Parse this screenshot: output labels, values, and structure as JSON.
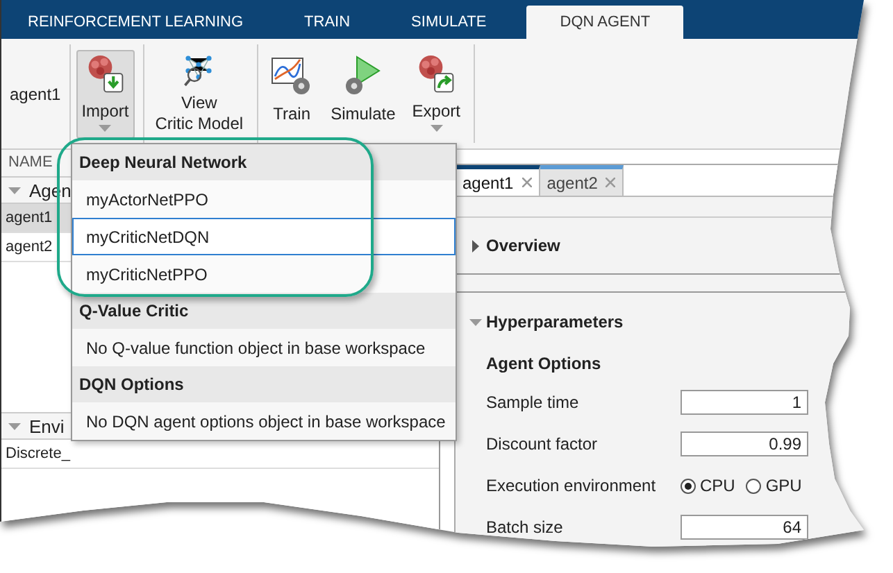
{
  "tabs": [
    {
      "label": "REINFORCEMENT LEARNING",
      "selected": false
    },
    {
      "label": "TRAIN",
      "selected": false
    },
    {
      "label": "SIMULATE",
      "selected": false
    },
    {
      "label": "DQN AGENT",
      "selected": true
    }
  ],
  "toolstrip": {
    "agent_label": "agent1",
    "groups": [
      [
        {
          "kind": "import",
          "label": "Import",
          "pressed": true,
          "has_menu": true
        }
      ],
      [
        {
          "kind": "view",
          "label": "View\nCritic Model",
          "pressed": false,
          "has_menu": false
        }
      ],
      [
        {
          "kind": "train",
          "label": "Train",
          "pressed": false,
          "has_menu": false
        },
        {
          "kind": "simulate",
          "label": "Simulate",
          "pressed": false,
          "has_menu": false
        },
        {
          "kind": "export",
          "label": "Export",
          "pressed": false,
          "has_menu": true
        }
      ]
    ]
  },
  "browser": {
    "name_header": "NAME",
    "sections": [
      {
        "title": "Agen",
        "expanded": true,
        "items": [
          {
            "label": "agent1",
            "selected": true
          },
          {
            "label": "agent2",
            "selected": false
          }
        ]
      },
      {
        "title": "Envi",
        "expanded": true,
        "items": [
          {
            "label": "Discrete_",
            "selected": false
          }
        ]
      }
    ]
  },
  "import_menu": {
    "sections": [
      {
        "header": "Deep Neural Network",
        "items": [
          {
            "kind": "option",
            "label": "myActorNetPPO",
            "selected": false
          },
          {
            "kind": "option",
            "label": "myCriticNetDQN",
            "selected": true
          },
          {
            "kind": "option",
            "label": "myCriticNetPPO",
            "selected": false
          }
        ]
      },
      {
        "header": "Q-Value Critic",
        "items": [
          {
            "kind": "message",
            "label": "No Q-value function object in base workspace"
          }
        ]
      },
      {
        "header": "DQN Options",
        "items": [
          {
            "kind": "message",
            "label": "No DQN agent options object in base workspace"
          }
        ]
      }
    ]
  },
  "document_tabs": [
    {
      "label": "agent1",
      "selected": true
    },
    {
      "label": "agent2",
      "selected": false
    }
  ],
  "overview": {
    "title": "Overview",
    "expanded": false
  },
  "hyperparameters": {
    "title": "Hyperparameters",
    "expanded": true,
    "group": "Agent Options",
    "params": [
      {
        "kind": "field",
        "label": "Sample time",
        "value": "1"
      },
      {
        "kind": "field",
        "label": "Discount factor",
        "value": "0.99"
      },
      {
        "kind": "radio",
        "label": "Execution environment",
        "options": [
          {
            "label": "CPU",
            "selected": true
          },
          {
            "label": "GPU",
            "selected": false
          }
        ]
      },
      {
        "kind": "field",
        "label": "Batch size",
        "value": "64"
      }
    ]
  }
}
